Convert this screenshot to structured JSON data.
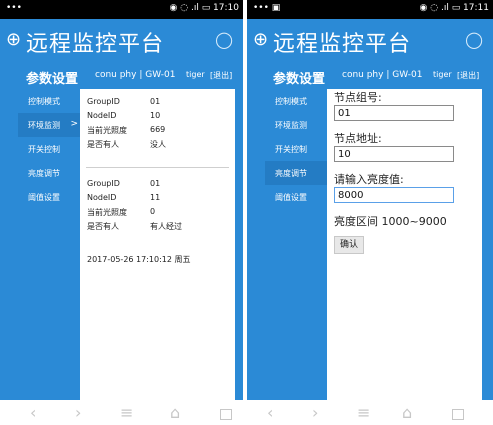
{
  "status_bar": {
    "left": "•••",
    "left_right_screen": "••• ▣",
    "right_left": "◉ ◌ .ıl ▭ 17:10",
    "right_right": "◉ ◌ .ıl ▭ 17:11"
  },
  "app": {
    "title": "远程监控平台",
    "icon": "globe-icon",
    "refresh_icon": "refresh-icon"
  },
  "header": {
    "title": "参数设置",
    "device": "conu phy | GW-01",
    "user": "tiger",
    "logout": "[退出]"
  },
  "screen1": {
    "sidebar": [
      {
        "label": "控制模式",
        "active": false
      },
      {
        "label": "环境监测",
        "active": true
      },
      {
        "label": "开关控制",
        "active": false
      },
      {
        "label": "亮度调节",
        "active": false
      },
      {
        "label": "阈值设置",
        "active": false
      }
    ],
    "active_arrow": ">",
    "node_blocks": [
      {
        "rows": [
          {
            "label": "GroupID",
            "value": "01"
          },
          {
            "label": "NodeID",
            "value": "10"
          },
          {
            "label": "当前光照度",
            "value": "669"
          },
          {
            "label": "是否有人",
            "value": "没人"
          }
        ]
      },
      {
        "rows": [
          {
            "label": "GroupID",
            "value": "01"
          },
          {
            "label": "NodeID",
            "value": "11"
          },
          {
            "label": "当前光照度",
            "value": "0"
          },
          {
            "label": "是否有人",
            "value": "有人经过"
          }
        ]
      }
    ],
    "timestamp": "2017-05-26 17:10:12 周五"
  },
  "screen2": {
    "sidebar": [
      {
        "label": "控制模式",
        "active": false
      },
      {
        "label": "环境监测",
        "active": false
      },
      {
        "label": "开关控制",
        "active": false
      },
      {
        "label": "亮度调节",
        "active": true
      },
      {
        "label": "阈值设置",
        "active": false
      }
    ],
    "form": {
      "group_label": "节点组号:",
      "group_value": "01",
      "address_label": "节点地址:",
      "address_value": "10",
      "brightness_label": "请输入亮度值:",
      "brightness_value": "8000",
      "range_note": "亮度区间 1000~9000",
      "confirm_label": "确认"
    }
  },
  "nav": {
    "back": "‹",
    "forward": "›",
    "menu": "≡",
    "home": "⌂",
    "recent": "recent-icon"
  },
  "colors": {
    "primary": "#2b8ad6",
    "active_item": "#247cc4",
    "status_bar": "#000000"
  }
}
